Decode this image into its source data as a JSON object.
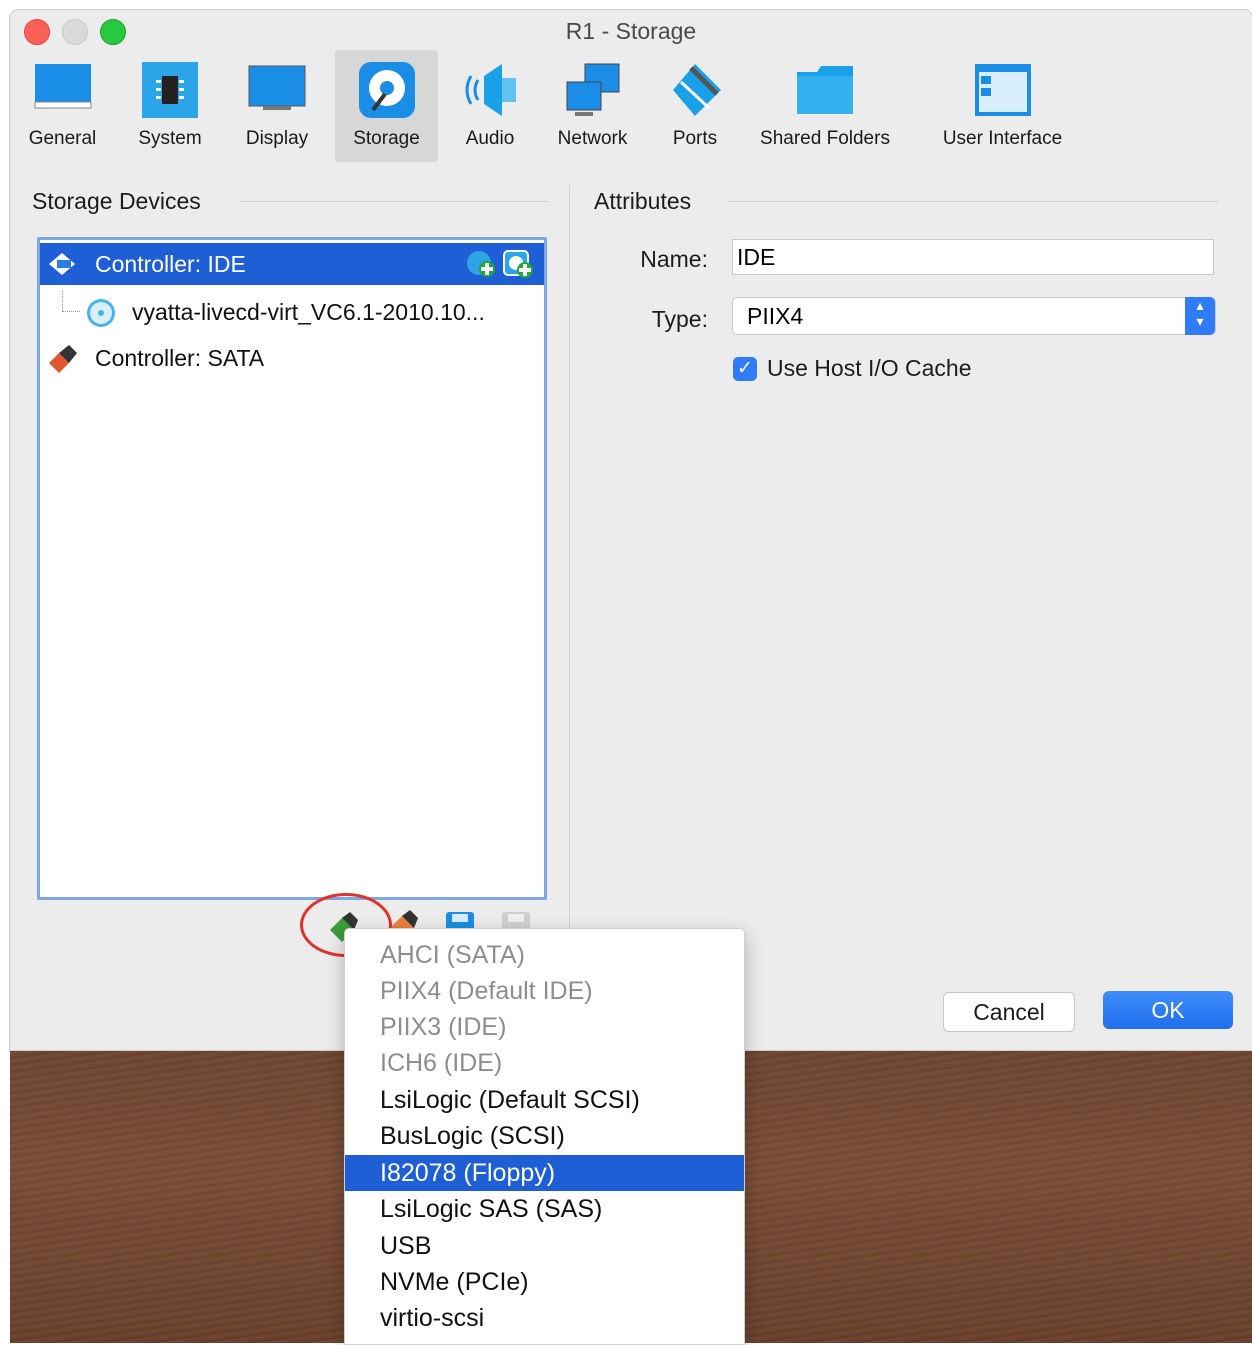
{
  "window": {
    "title": "R1 - Storage"
  },
  "toolbar": {
    "items": [
      {
        "label": "General",
        "icon": "general-icon"
      },
      {
        "label": "System",
        "icon": "system-chip-icon"
      },
      {
        "label": "Display",
        "icon": "display-monitor-icon"
      },
      {
        "label": "Storage",
        "icon": "storage-disk-icon",
        "active": true
      },
      {
        "label": "Audio",
        "icon": "audio-speaker-icon"
      },
      {
        "label": "Network",
        "icon": "network-icon"
      },
      {
        "label": "Ports",
        "icon": "ports-icon"
      },
      {
        "label": "Shared Folders",
        "icon": "folder-icon"
      },
      {
        "label": "User Interface",
        "icon": "user-interface-icon"
      }
    ]
  },
  "storage": {
    "header": "Storage Devices",
    "tree": [
      {
        "label": "Controller: IDE",
        "selected": true
      },
      {
        "label": "vyatta-livecd-virt_VC6.1-2010.10..."
      },
      {
        "label": "Controller: SATA"
      }
    ]
  },
  "attributes": {
    "header": "Attributes",
    "name_label": "Name:",
    "name_value": "IDE",
    "type_label": "Type:",
    "type_value": "PIIX4",
    "cache_label": "Use Host I/O Cache",
    "cache_checked": true
  },
  "buttons": {
    "cancel": "Cancel",
    "ok": "OK"
  },
  "menu": {
    "items": [
      {
        "label": "AHCI (SATA)",
        "enabled": false
      },
      {
        "label": "PIIX4 (Default IDE)",
        "enabled": false
      },
      {
        "label": "PIIX3 (IDE)",
        "enabled": false
      },
      {
        "label": "ICH6 (IDE)",
        "enabled": false
      },
      {
        "label": "LsiLogic (Default SCSI)",
        "enabled": true
      },
      {
        "label": "BusLogic (SCSI)",
        "enabled": true
      },
      {
        "label": "I82078 (Floppy)",
        "enabled": true,
        "highlighted": true
      },
      {
        "label": "LsiLogic SAS (SAS)",
        "enabled": true
      },
      {
        "label": "USB",
        "enabled": true
      },
      {
        "label": "NVMe (PCIe)",
        "enabled": true
      },
      {
        "label": "virtio-scsi",
        "enabled": true
      }
    ]
  },
  "colors": {
    "accent": "#1e5fd6",
    "highlight_ring": "#e0322b"
  }
}
